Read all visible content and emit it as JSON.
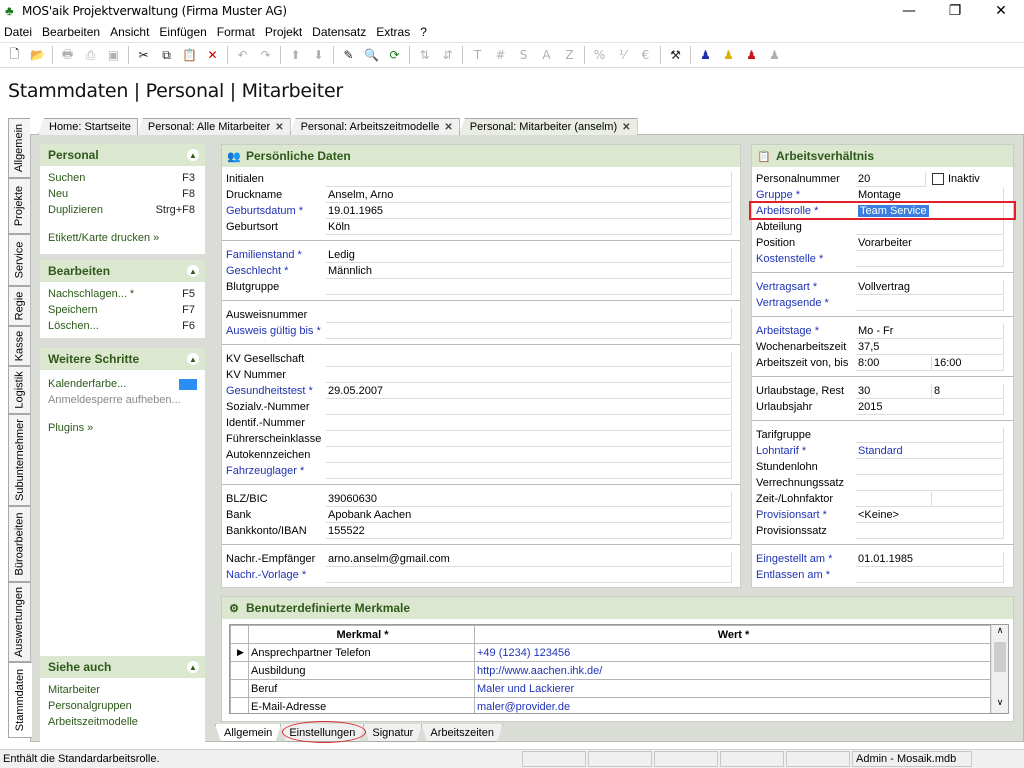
{
  "window": {
    "title": "MOS'aik Projektverwaltung (Firma Muster AG)",
    "minimize": "—",
    "maximize": "❐",
    "close": "✕"
  },
  "menu": [
    "Datei",
    "Bearbeiten",
    "Ansicht",
    "Einfügen",
    "Format",
    "Projekt",
    "Datensatz",
    "Extras",
    "?"
  ],
  "page_title": "Stammdaten | Personal | Mitarbeiter",
  "doc_tabs": [
    {
      "label": "Home: Startseite",
      "closable": false
    },
    {
      "label": "Personal: Alle Mitarbeiter",
      "closable": true
    },
    {
      "label": "Personal: Arbeitszeitmodelle",
      "closable": true
    },
    {
      "label": "Personal: Mitarbeiter (anselm)",
      "closable": true
    }
  ],
  "side_tabs": [
    "Allgemein",
    "Projekte",
    "Service",
    "Regie",
    "Kasse",
    "Logistik",
    "Subunternehmer",
    "Büroarbeiten",
    "Auswertungen",
    "Stammdaten"
  ],
  "left_panel": {
    "personal": {
      "title": "Personal",
      "items": [
        {
          "label": "Suchen",
          "key": "F3"
        },
        {
          "label": "Neu",
          "key": "F8"
        },
        {
          "label": "Duplizieren",
          "key": "Strg+F8"
        }
      ],
      "extra": "Etikett/Karte drucken »"
    },
    "bearbeiten": {
      "title": "Bearbeiten",
      "items": [
        {
          "label": "Nachschlagen... *",
          "key": "F5"
        },
        {
          "label": "Speichern",
          "key": "F7"
        },
        {
          "label": "Löschen...",
          "key": "F6"
        }
      ]
    },
    "weitere": {
      "title": "Weitere Schritte",
      "kalender": "Kalenderfarbe...",
      "anmelde": "Anmeldesperre aufheben...",
      "plugins": "Plugins »",
      "swatch_color": "#2a8ef2"
    },
    "siehe": {
      "title": "Siehe auch",
      "items": [
        "Mitarbeiter",
        "Personalgruppen",
        "Arbeitszeitmodelle"
      ]
    }
  },
  "persoenlich": {
    "title": "Persönliche Daten",
    "rows": [
      {
        "label": "Initialen",
        "value": "",
        "req": false
      },
      {
        "label": "Druckname",
        "value": "Anselm, Arno",
        "req": false
      },
      {
        "label": "Geburtsdatum *",
        "value": "19.01.1965",
        "req": true
      },
      {
        "label": "Geburtsort",
        "value": "Köln",
        "req": false
      },
      {
        "label": "Familienstand *",
        "value": "Ledig",
        "req": true
      },
      {
        "label": "Geschlecht *",
        "value": "Männlich",
        "req": true
      },
      {
        "label": "Blutgruppe",
        "value": "",
        "req": false
      },
      {
        "label": "Ausweisnummer",
        "value": "",
        "req": false
      },
      {
        "label": "Ausweis gültig bis *",
        "value": "",
        "req": true
      },
      {
        "label": "KV Gesellschaft",
        "value": "",
        "req": false
      },
      {
        "label": "KV Nummer",
        "value": "",
        "req": false
      },
      {
        "label": "Gesundheitstest *",
        "value": "29.05.2007",
        "req": true
      },
      {
        "label": "Sozialv.-Nummer",
        "value": "",
        "req": false
      },
      {
        "label": "Identif.-Nummer",
        "value": "",
        "req": false
      },
      {
        "label": "Führerscheinklasse",
        "value": "",
        "req": false
      },
      {
        "label": "Autokennzeichen",
        "value": "",
        "req": false
      },
      {
        "label": "Fahrzeuglager *",
        "value": "",
        "req": true
      },
      {
        "label": "BLZ/BIC",
        "value": "39060630",
        "req": false
      },
      {
        "label": "Bank",
        "value": "Apobank Aachen",
        "req": false
      },
      {
        "label": "Bankkonto/IBAN",
        "value": "155522",
        "req": false
      },
      {
        "label": "Nachr.-Empfänger",
        "value": "arno.anselm@gmail.com",
        "req": false
      },
      {
        "label": "Nachr.-Vorlage *",
        "value": "",
        "req": true
      }
    ]
  },
  "arbeit": {
    "title": "Arbeitsverhältnis",
    "inaktiv": "Inaktiv",
    "rows": [
      {
        "label": "Personalnummer",
        "value": "20",
        "value2": null,
        "req": false
      },
      {
        "label": "Gruppe *",
        "value": "Montage",
        "value2": null,
        "req": true
      },
      {
        "label": "Arbeitsrolle *",
        "value": "Team Service",
        "value2": null,
        "req": true
      },
      {
        "label": "Abteilung",
        "value": "",
        "value2": null,
        "req": false
      },
      {
        "label": "Position",
        "value": "Vorarbeiter",
        "value2": null,
        "req": false
      },
      {
        "label": "Kostenstelle *",
        "value": "",
        "value2": null,
        "req": true
      },
      {
        "label": "Vertragsart *",
        "value": "Vollvertrag",
        "value2": null,
        "req": true
      },
      {
        "label": "Vertragsende *",
        "value": "",
        "value2": null,
        "req": true
      },
      {
        "label": "Arbeitstage *",
        "value": "Mo - Fr",
        "value2": null,
        "req": true
      },
      {
        "label": "Wochenarbeitszeit",
        "value": "37,5",
        "value2": null,
        "req": false
      },
      {
        "label": "Arbeitszeit von, bis",
        "value": "8:00",
        "value2": "16:00",
        "req": false
      },
      {
        "label": "Urlaubstage, Rest",
        "value": "30",
        "value2": "8",
        "req": false
      },
      {
        "label": "Urlaubsjahr",
        "value": "2015",
        "value2": null,
        "req": false
      },
      {
        "label": "Tarifgruppe",
        "value": "",
        "value2": null,
        "req": false
      },
      {
        "label": "Lohntarif *",
        "value": "Standard",
        "value2": null,
        "req": true
      },
      {
        "label": "Stundenlohn",
        "value": "",
        "value2": null,
        "req": false
      },
      {
        "label": "Verrechnungssatz",
        "value": "",
        "value2": null,
        "req": false
      },
      {
        "label": "Zeit-/Lohnfaktor",
        "value": "",
        "value2": "",
        "req": false
      },
      {
        "label": "Provisionsart *",
        "value": "<Keine>",
        "value2": null,
        "req": true
      },
      {
        "label": "Provisionssatz",
        "value": "",
        "value2": null,
        "req": false
      },
      {
        "label": "Eingestellt am *",
        "value": "01.01.1985",
        "value2": null,
        "req": true
      },
      {
        "label": "Entlassen am *",
        "value": "",
        "value2": null,
        "req": true
      }
    ]
  },
  "merkmale": {
    "title": "Benutzerdefinierte Merkmale",
    "columns": [
      "Merkmal *",
      "Wert *"
    ],
    "rows": [
      {
        "name": "Ansprechpartner Telefon",
        "value": "+49 (1234) 123456"
      },
      {
        "name": "Ausbildung",
        "value": "http://www.aachen.ihk.de/"
      },
      {
        "name": "Beruf",
        "value": "Maler und Lackierer"
      },
      {
        "name": "E-Mail-Adresse",
        "value": "maler@provider.de"
      }
    ]
  },
  "bottom_tabs": [
    "Allgemein",
    "Einstellungen",
    "Signatur",
    "Arbeitszeiten"
  ],
  "status": {
    "text": "Enthält die Standardarbeitsrolle.",
    "right": "Admin - Mosaik.mdb"
  }
}
